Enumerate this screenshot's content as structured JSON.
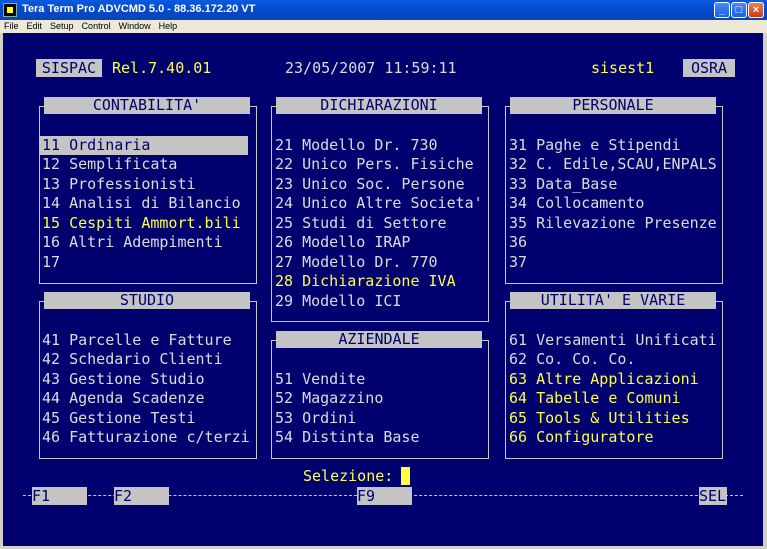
{
  "window": {
    "title": "Tera Term Pro ADVCMD 5.0 - 88.36.172.20 VT",
    "minimize": "_",
    "maximize": "□",
    "close": "×"
  },
  "menu": [
    "File",
    "Edit",
    "Setup",
    "Control",
    "Window",
    "Help"
  ],
  "header": {
    "left_box": "SISPAC",
    "release": "Rel.7.40.01",
    "datetime": "23/05/2007 11:59:11",
    "user": "sisest1",
    "right_box": "OSRA"
  },
  "panels": {
    "contabilita": {
      "title": "CONTABILITA'",
      "items": [
        "11 Ordinaria",
        "12 Semplificata",
        "13 Professionisti",
        "14 Analisi di Bilancio",
        "15 Cespiti Ammort.bili",
        "16 Altri Adempimenti",
        "17"
      ]
    },
    "dichiarazioni": {
      "title": "DICHIARAZIONI",
      "items": [
        "21 Modello Dr. 730",
        "22 Unico Pers. Fisiche",
        "23 Unico Soc. Persone",
        "24 Unico Altre Societa'",
        "25 Studi di Settore",
        "26 Modello IRAP",
        "27 Modello Dr. 770",
        "28 Dichiarazione IVA",
        "29 Modello ICI"
      ]
    },
    "personale": {
      "title": "PERSONALE",
      "items": [
        "31 Paghe e Stipendi",
        "32 C. Edile,SCAU,ENPALS",
        "33 Data_Base",
        "34 Collocamento",
        "35 Rilevazione Presenze",
        "36",
        "37"
      ]
    },
    "studio": {
      "title": "STUDIO",
      "items": [
        "41 Parcelle e Fatture",
        "42 Schedario Clienti",
        "43 Gestione Studio",
        "44 Agenda Scadenze",
        "45 Gestione Testi",
        "46 Fatturazione c/terzi"
      ]
    },
    "aziendale": {
      "title": "AZIENDALE",
      "items": [
        "51 Vendite",
        "52 Magazzino",
        "53 Ordini",
        "54 Distinta Base"
      ]
    },
    "utilita": {
      "title": "UTILITA' E VARIE",
      "items": [
        "61 Versamenti Unificati",
        "62 Co. Co. Co.",
        "63 Altre Applicazioni",
        "64 Tabelle e Comuni",
        "65 Tools & Utilities",
        "66 Configuratore"
      ]
    }
  },
  "selection": {
    "label": "Selezione:",
    "value": ""
  },
  "function_keys": {
    "f1": "F1",
    "f2": "F2",
    "f9": "F9",
    "sel": "SEL"
  },
  "colors": {
    "background": "#00006e",
    "text": "#dcdcdc",
    "highlight_text": "#ffff44",
    "box": "#c4c4c4"
  }
}
